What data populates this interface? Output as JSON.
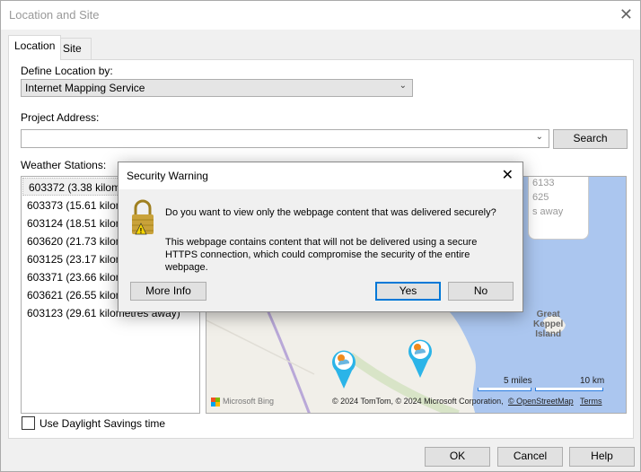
{
  "window": {
    "title": "Location and Site",
    "close": "✕"
  },
  "tabs": [
    {
      "label": "Location"
    },
    {
      "label": "Site"
    }
  ],
  "location": {
    "define_label": "Define Location by:",
    "define_value": "Internet Mapping Service",
    "address_label": "Project Address:",
    "address_value": "",
    "search_button": "Search",
    "stations_label": "Weather Stations:",
    "stations": [
      "603372 (3.38 kilometres away)",
      "603373 (15.61 kilometres away)",
      "603124 (18.51 kilometres away)",
      "603620 (21.73 kilometres away)",
      "603125 (23.17 kilometres away)",
      "603371 (23.66 kilometres away)",
      "603621 (26.55 kilometres away)",
      "603123 (29.61 kilometres away)"
    ],
    "dst_label": "Use Daylight Savings time",
    "dst_checked": false
  },
  "map": {
    "popup_lines": [
      "6133",
      "625",
      "s away"
    ],
    "place_label_lines": [
      "Great",
      "Keppel",
      "Island"
    ],
    "scale_miles": "5 miles",
    "scale_km": "10 km",
    "brand": "Microsoft Bing",
    "copyright": "© 2024 TomTom, © 2024 Microsoft Corporation,",
    "osm_link": "© OpenStreetMap",
    "terms_link": "Terms"
  },
  "footer": {
    "ok": "OK",
    "cancel": "Cancel",
    "help": "Help"
  },
  "dialog": {
    "title": "Security Warning",
    "close": "✕",
    "question": "Do you want to view only the webpage content that was delivered securely?",
    "detail": "This webpage contains content that will not be delivered using a secure HTTPS connection, which could compromise the security of the entire webpage.",
    "more_info": "More Info",
    "yes": "Yes",
    "no": "No"
  },
  "colors": {
    "accent": "#0078d7",
    "water": "#abc6ef",
    "land": "#f1efe9"
  }
}
